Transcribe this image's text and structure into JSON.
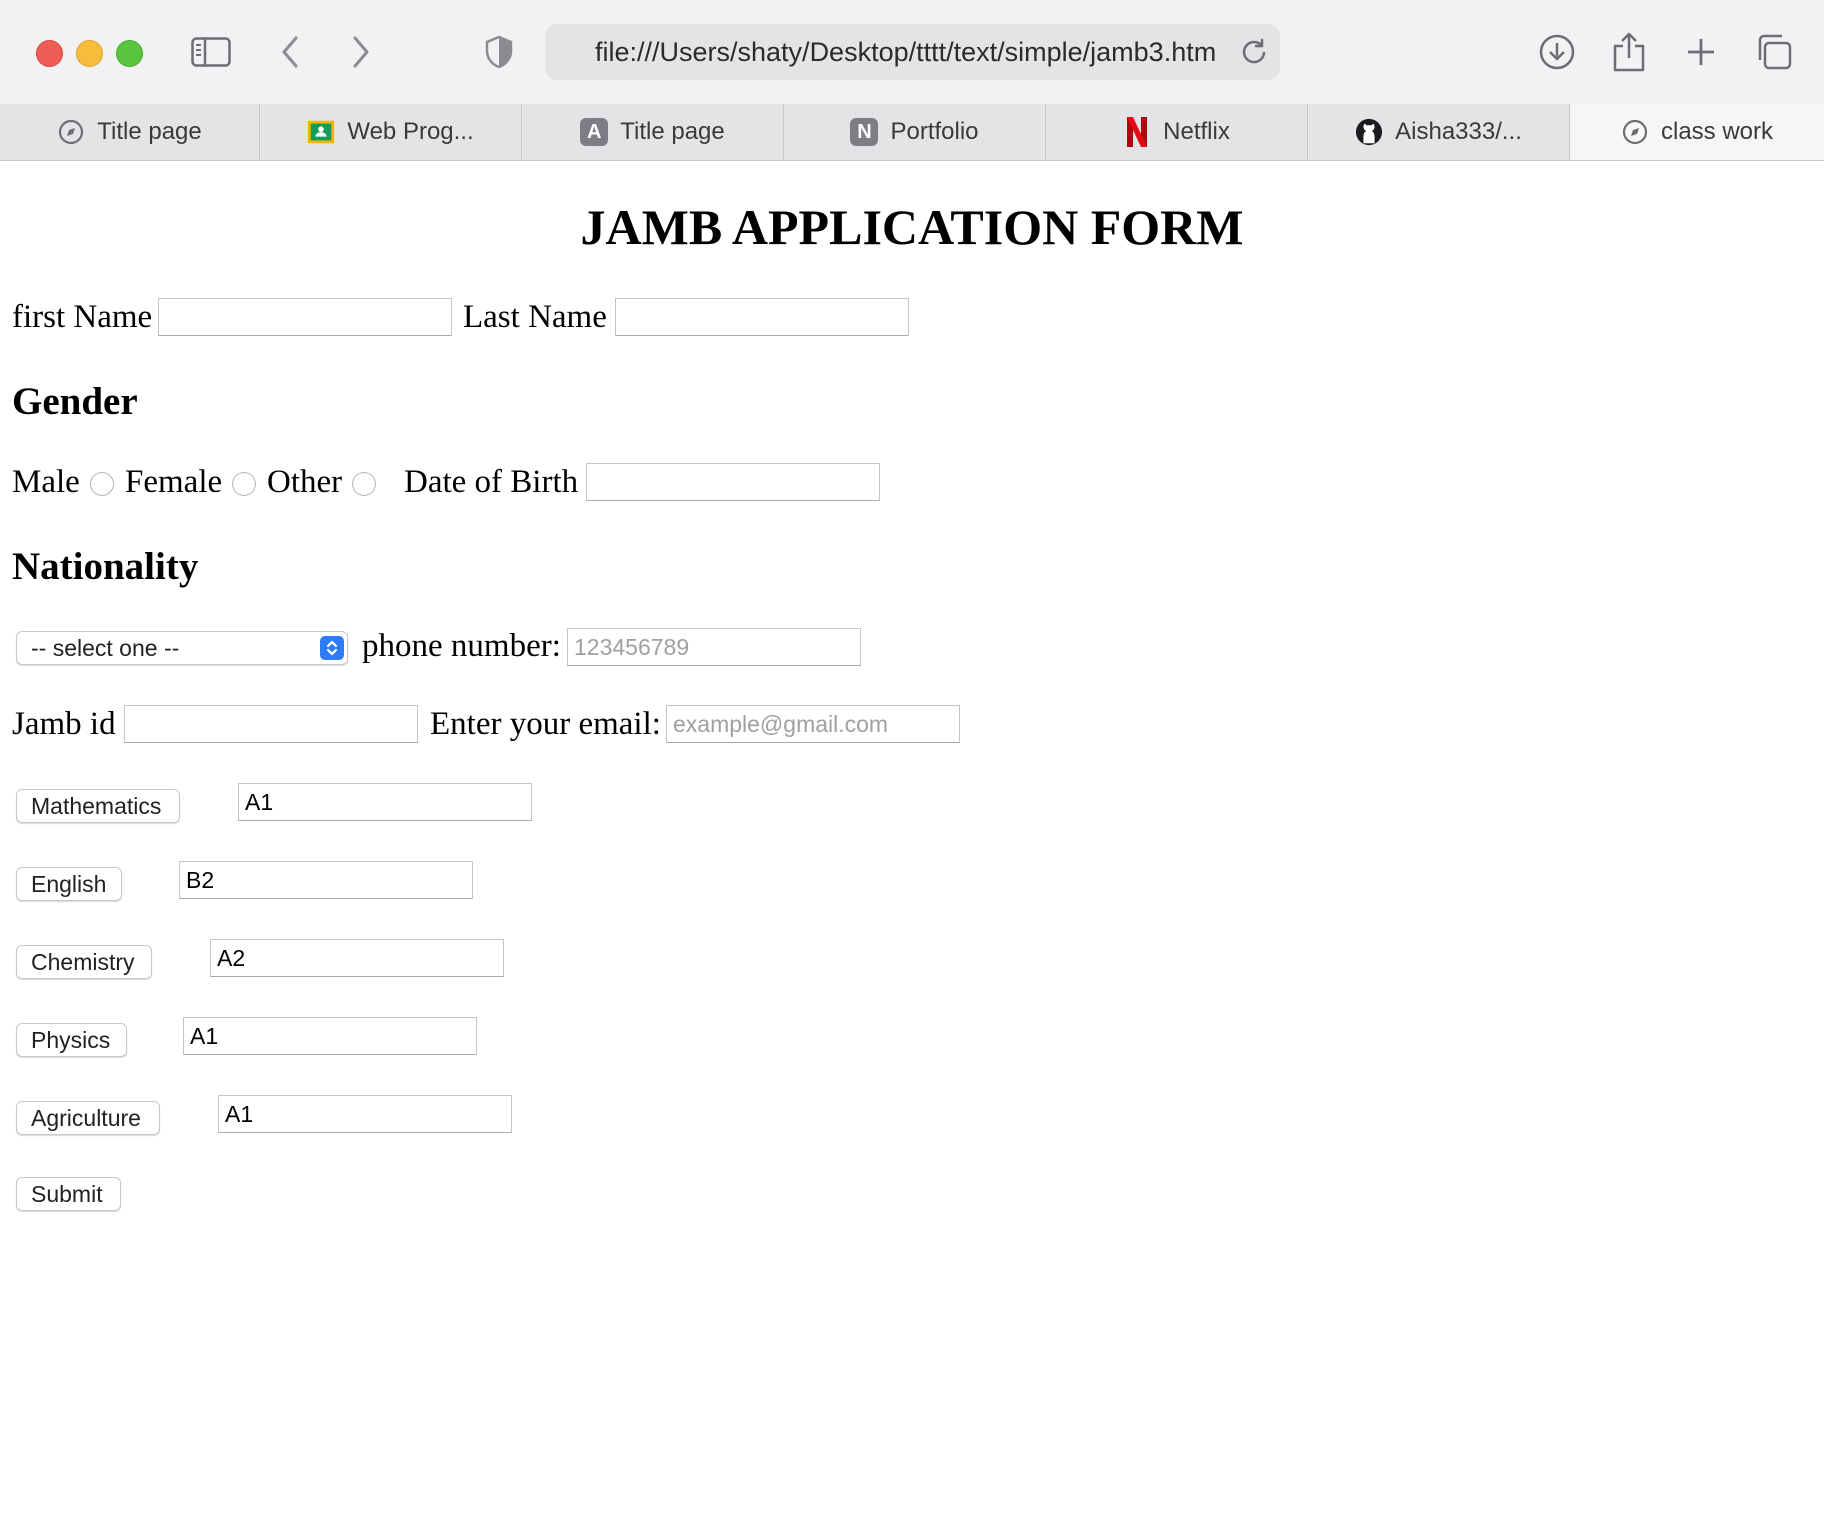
{
  "browser": {
    "url": "file:///Users/shaty/Desktop/tttt/text/simple/jamb3.html",
    "tabs": [
      {
        "title": "Title page",
        "icon": "compass-icon"
      },
      {
        "title": "Web Prog...",
        "icon": "google-classroom-icon"
      },
      {
        "title": "Title page",
        "icon": "letter-a-icon",
        "letter": "A"
      },
      {
        "title": "Portfolio",
        "icon": "letter-n-icon",
        "letter": "N"
      },
      {
        "title": "Netflix",
        "icon": "netflix-icon"
      },
      {
        "title": "Aisha333/...",
        "icon": "github-icon"
      },
      {
        "title": "class work",
        "icon": "compass-icon",
        "active": true
      }
    ]
  },
  "form": {
    "title": "JAMB APPLICATION FORM",
    "first_name_label": "first Name",
    "last_name_label": "Last Name",
    "gender_heading": "Gender",
    "gender_options": [
      "Male",
      "Female",
      "Other"
    ],
    "dob_label": "Date of Birth",
    "nationality_heading": "Nationality",
    "nationality_selected": "-- select one --",
    "phone_label": "phone number:",
    "phone_placeholder": "123456789",
    "jamb_id_label": "Jamb id",
    "email_label": "Enter your email:",
    "email_placeholder": "example@gmail.com",
    "subjects": [
      {
        "name": "Mathematics",
        "grade": "A1"
      },
      {
        "name": "English",
        "grade": "B2"
      },
      {
        "name": "Chemistry",
        "grade": "A2"
      },
      {
        "name": "Physics",
        "grade": "A1"
      },
      {
        "name": "Agriculture",
        "grade": "A1"
      }
    ],
    "submit_label": "Submit"
  },
  "colors": {
    "select_accent": "#2f7df6",
    "netflix_red": "#d81f26",
    "traffic_red": "#ee5e57",
    "traffic_yellow": "#f6bd3d",
    "traffic_green": "#5bc53f"
  }
}
